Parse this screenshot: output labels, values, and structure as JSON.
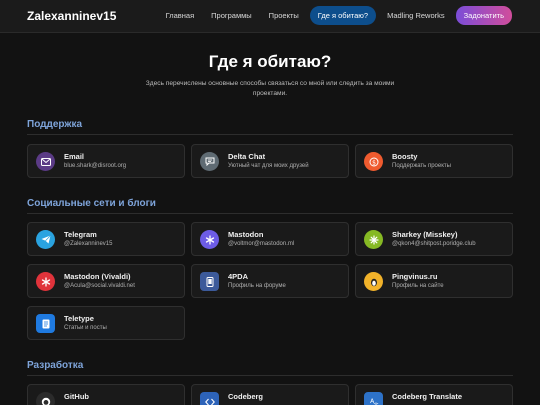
{
  "brand": "Zalexanninev15",
  "nav": {
    "home": "Главная",
    "programs": "Программы",
    "projects": "Проекты",
    "where": "Где я обитаю?",
    "madling": "Madling Reworks",
    "donate": "Задонатить"
  },
  "hero": {
    "title": "Где я обитаю?",
    "subtitle": "Здесь перечислены основные способы связаться со мной или следить за моими проектами."
  },
  "sections": {
    "support": "Поддержка",
    "social": "Социальные сети и блоги",
    "dev": "Разработка"
  },
  "cards": {
    "email": {
      "name": "Email",
      "desc": "blue.shark@disroot.org",
      "color": "#6b3fa0",
      "icon": "mail-icon"
    },
    "deltachat": {
      "name": "Delta Chat",
      "desc": "Уютный чат для моих друзей",
      "color": "#5f6b73",
      "icon": "chat-icon"
    },
    "boosty": {
      "name": "Boosty",
      "desc": "Поддержать проекты",
      "color": "#ef5b2f",
      "icon": "coin-icon"
    },
    "telegram": {
      "name": "Telegram",
      "desc": "@Zalexanninev15",
      "color": "#2aa3e0",
      "icon": "paper-plane-icon"
    },
    "mastodon": {
      "name": "Mastodon",
      "desc": "@voltmor@mastodon.ml",
      "color": "#6d5ce6",
      "icon": "mastodon-icon"
    },
    "sharkey": {
      "name": "Sharkey (Misskey)",
      "desc": "@qkon4@shitpost.poridge.club",
      "color": "#86b924",
      "icon": "sharkey-icon"
    },
    "vivaldi": {
      "name": "Mastodon (Vivaldi)",
      "desc": "@Acula@social.vivaldi.net",
      "color": "#e0333b",
      "icon": "vivaldi-icon"
    },
    "4pda": {
      "name": "4PDA",
      "desc": "Профиль на форуме",
      "color": "#3c5a9a",
      "icon": "phone-icon"
    },
    "pingvinus": {
      "name": "Pingvinus.ru",
      "desc": "Профиль на сайте",
      "color": "#f1b22a",
      "icon": "penguin-icon"
    },
    "teletype": {
      "name": "Teletype",
      "desc": "Статьи и посты",
      "color": "#1f7ae0",
      "icon": "document-icon"
    },
    "github": {
      "name": "GitHub",
      "desc": "",
      "color": "#2b2b2b",
      "icon": "github-icon"
    },
    "codeberg": {
      "name": "Codeberg",
      "desc": "",
      "color": "#2d63b8",
      "icon": "code-icon"
    },
    "codeberg_translate": {
      "name": "Codeberg Translate",
      "desc": "",
      "color": "#2d72c8",
      "icon": "translate-icon"
    }
  }
}
